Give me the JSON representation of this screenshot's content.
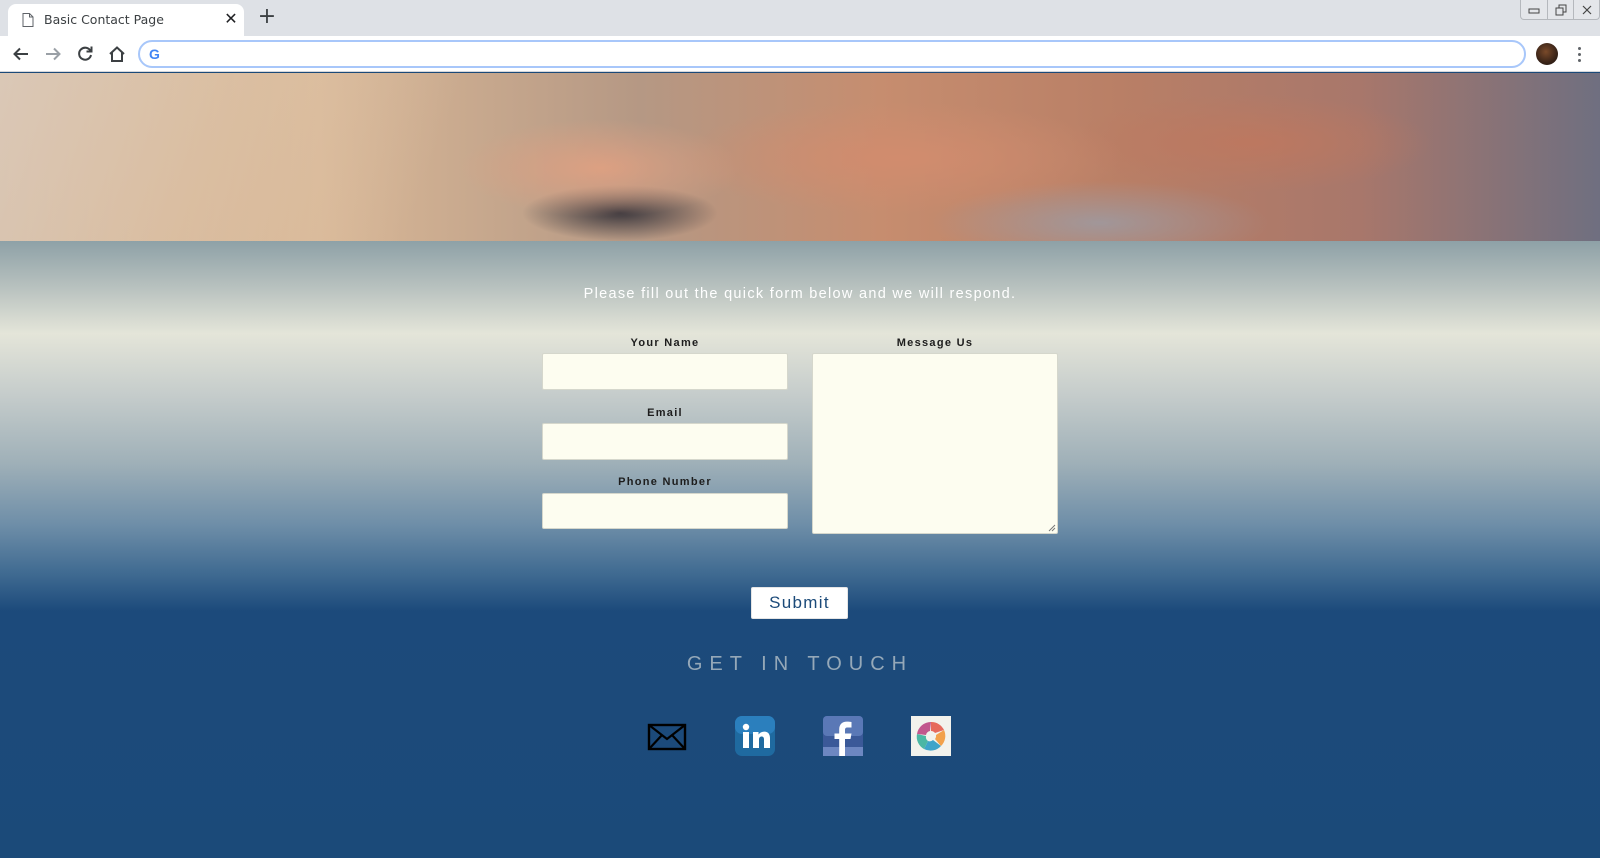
{
  "browser": {
    "tab_title": "Basic Contact Page",
    "tab_close": "✕",
    "new_tab": "+",
    "address_value": "",
    "omnibox_logo": "G"
  },
  "page": {
    "intro": "Please fill out the quick form below and we will respond.",
    "form": {
      "name_label": "Your Name",
      "email_label": "Email",
      "phone_label": "Phone Number",
      "message_label": "Message Us",
      "name_value": "",
      "email_value": "",
      "phone_value": "",
      "message_value": ""
    },
    "submit_label": "Submit",
    "get_in_touch": "GET IN TOUCH",
    "social": [
      "email-icon",
      "linkedin-icon",
      "facebook-icon",
      "sourceforge-icon"
    ]
  },
  "colors": {
    "page_blue": "#1b4a79",
    "field_bg": "#fdfdf0",
    "linkedin": "#1f6aa0",
    "facebook": "#3b5998"
  }
}
